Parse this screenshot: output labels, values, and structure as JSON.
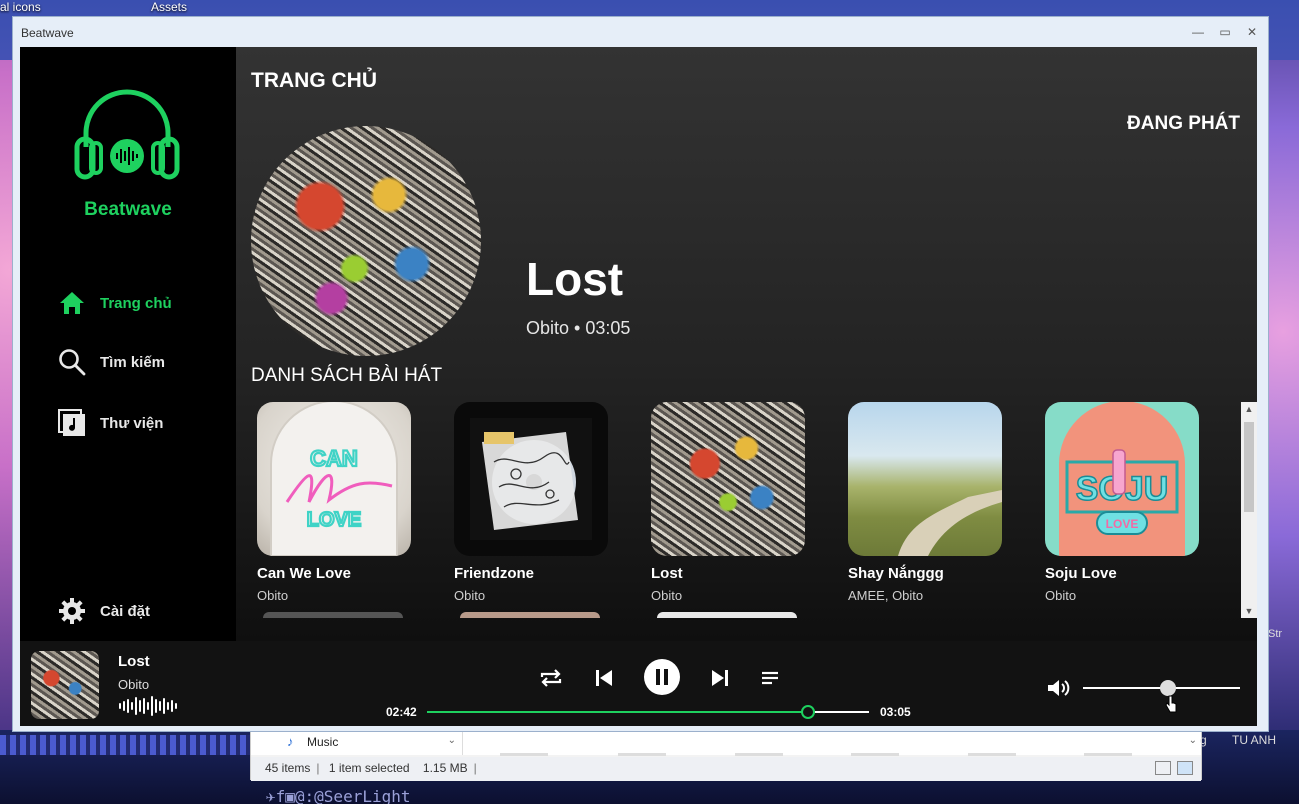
{
  "desktop": {
    "icons_label": "al icons",
    "assets_label": "Assets",
    "right_text": "Str",
    "credit": "✈f▣@:@SeerLight",
    "outside_g": "g",
    "outside_anh": "TU ANH"
  },
  "explorer": {
    "nav_item": "Music",
    "status_items": "45 items",
    "status_selected": "1 item selected",
    "status_size": "1.15 MB"
  },
  "window": {
    "title": "Beatwave",
    "minimize": "—",
    "maximize": "▭",
    "close": "✕"
  },
  "sidebar": {
    "brand": "Beatwave",
    "nav": [
      {
        "label": "Trang chủ",
        "icon": "home-icon",
        "active": true
      },
      {
        "label": "Tìm kiếm",
        "icon": "search-icon",
        "active": false
      },
      {
        "label": "Thư viện",
        "icon": "library-icon",
        "active": false
      }
    ],
    "settings_label": "Cài đặt"
  },
  "main": {
    "page_title": "TRANG CHỦ",
    "now_playing_label": "ĐANG PHÁT",
    "current_song": {
      "title": "Lost",
      "meta": "Obito • 03:05"
    },
    "section_title": "DANH SÁCH BÀI HÁT",
    "songs": [
      {
        "title": "Can We Love",
        "artist": "Obito",
        "art_text_1": "CAN",
        "art_text_2": "LOVE"
      },
      {
        "title": "Friendzone",
        "artist": "Obito"
      },
      {
        "title": "Lost",
        "artist": "Obito"
      },
      {
        "title": "Shay Nắnggg",
        "artist": "AMEE, Obito"
      },
      {
        "title": "Soju Love",
        "artist": "Obito",
        "art_text_1": "SOJU",
        "art_text_2": "LOVE"
      }
    ]
  },
  "player": {
    "title": "Lost",
    "artist": "Obito",
    "elapsed": "02:42",
    "duration": "03:05",
    "progress_fraction": 0.862,
    "volume_fraction": 0.54,
    "accent": "#1ed15f"
  }
}
